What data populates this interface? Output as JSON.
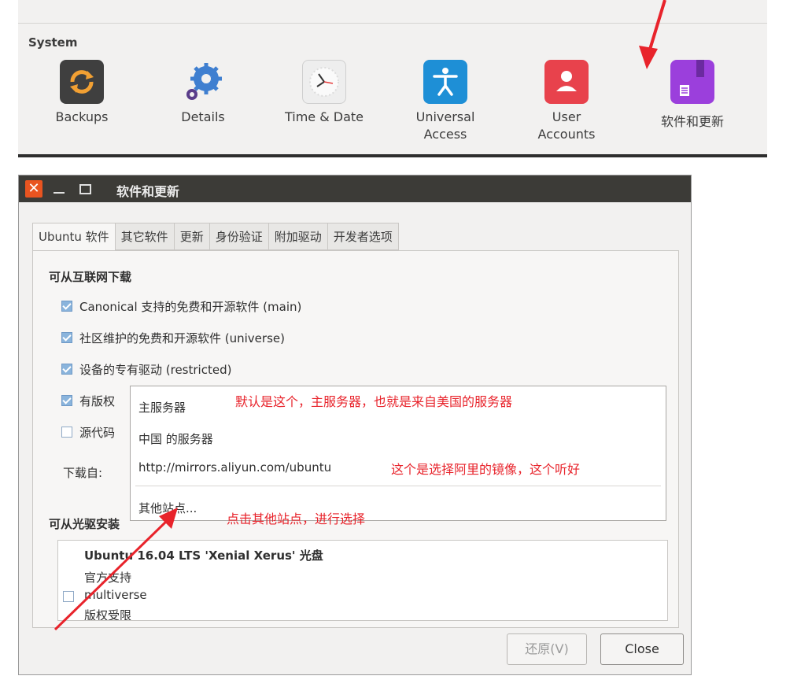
{
  "system": {
    "title": "System",
    "items": [
      {
        "label": "Backups",
        "icon": "backup-icon"
      },
      {
        "label": "Details",
        "icon": "gears-icon"
      },
      {
        "label": "Time & Date",
        "icon": "clock-icon"
      },
      {
        "label": "Universal Access",
        "icon": "accessibility-icon"
      },
      {
        "label": "User Accounts",
        "icon": "user-icon"
      },
      {
        "label": "软件和更新",
        "icon": "software-package-icon"
      }
    ]
  },
  "window": {
    "title": "软件和更新",
    "close_glyph": "✕"
  },
  "tabs": [
    {
      "label": "Ubuntu 软件",
      "active": true
    },
    {
      "label": "其它软件",
      "active": false
    },
    {
      "label": "更新",
      "active": false
    },
    {
      "label": "身份验证",
      "active": false
    },
    {
      "label": "附加驱动",
      "active": false
    },
    {
      "label": "开发者选项",
      "active": false
    }
  ],
  "internet": {
    "title": "可从互联网下载",
    "options": [
      {
        "label": "Canonical 支持的免费和开源软件 (main)",
        "checked": true
      },
      {
        "label": "社区维护的免费和开源软件 (universe)",
        "checked": true
      },
      {
        "label": "设备的专有驱动 (restricted)",
        "checked": true
      },
      {
        "label": "有版权",
        "checked": true
      },
      {
        "label": "源代码",
        "checked": false
      }
    ],
    "download_from_label": "下载自:"
  },
  "dropdown": {
    "items": [
      "主服务器",
      "中国 的服务器",
      "http://mirrors.aliyun.com/ubuntu",
      "其他站点..."
    ]
  },
  "cdrom": {
    "title": "可从光驱安装",
    "disc_title": "Ubuntu 16.04 LTS 'Xenial Xerus' 光盘",
    "lines": [
      "官方支持",
      "multiverse",
      "版权受限"
    ]
  },
  "buttons": {
    "revert": "还原(V)",
    "close": "Close"
  },
  "annotations": {
    "main_server": "默认是这个，主服务器，也就是来自美国的服务器",
    "aliyun": "这个是选择阿里的镜像，这个听好",
    "other_sites": "点击其他站点，进行选择"
  },
  "colors": {
    "annotation": "#e8232b",
    "titlebar": "#3c3b37",
    "close_button": "#e95420"
  }
}
